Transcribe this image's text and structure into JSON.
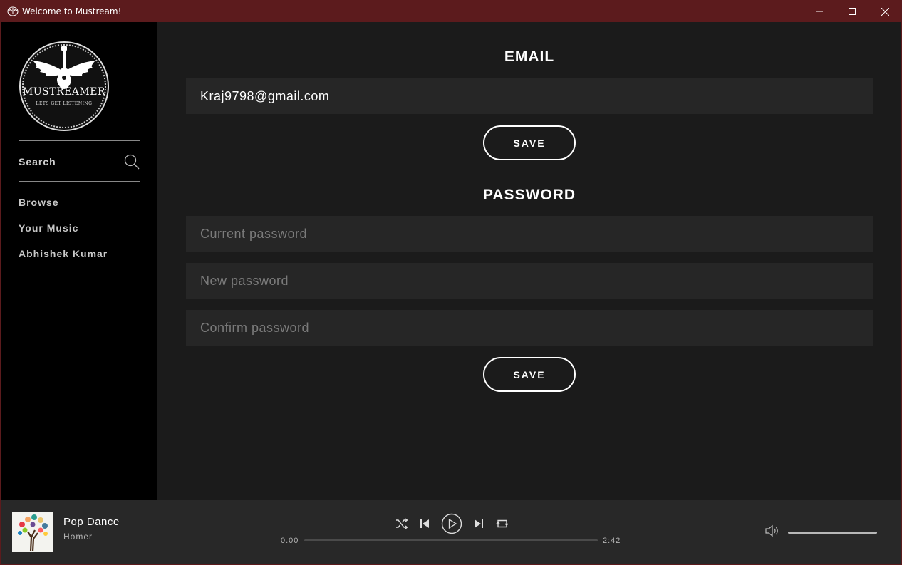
{
  "window": {
    "title": "Welcome to Mustream!",
    "app_icon": "mustream-wings-icon",
    "controls": [
      "minimize-icon",
      "maximize-icon",
      "close-icon"
    ]
  },
  "sidebar": {
    "logo": {
      "name": "MUSTREAMER",
      "tagline": "LETS GET LISTENING"
    },
    "search_label": "Search",
    "search_icon": "search-icon",
    "items": [
      {
        "label": "Browse"
      },
      {
        "label": "Your Music"
      },
      {
        "label": "Abhishek Kumar"
      }
    ]
  },
  "email_section": {
    "title": "EMAIL",
    "email_value": "Kraj9798@gmail.com",
    "save_label": "SAVE"
  },
  "password_section": {
    "title": "PASSWORD",
    "current_placeholder": "Current password",
    "new_placeholder": "New password",
    "confirm_placeholder": "Confirm password",
    "save_label": "SAVE"
  },
  "player": {
    "track_title": "Pop Dance",
    "artist": "Homer",
    "elapsed": "0.00",
    "duration": "2:42",
    "progress_fraction": 0.0,
    "volume_fraction": 1.0,
    "icons": [
      "shuffle-icon",
      "previous-icon",
      "play-icon",
      "next-icon",
      "repeat-icon",
      "volume-icon"
    ]
  },
  "colors": {
    "titlebar": "#5c1b1d",
    "sidebar": "#000000",
    "main": "#1b1b1b",
    "input": "#262626",
    "player": "#282828"
  }
}
